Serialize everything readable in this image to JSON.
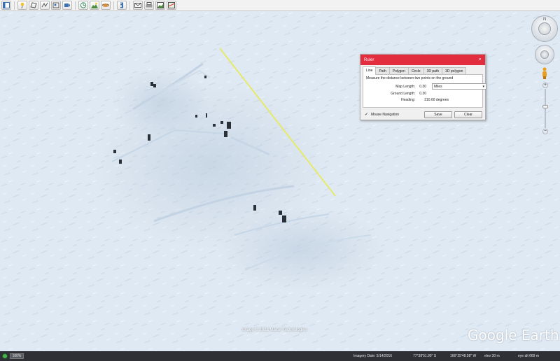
{
  "toolbar": {
    "buttons": [
      "sidebar",
      "placemark",
      "polygon",
      "path",
      "image-overlay",
      "record-tour",
      "historical-imagery",
      "sun",
      "planets",
      "ruler",
      "email",
      "print",
      "save-image",
      "view-in-maps"
    ]
  },
  "ruler": {
    "title": "Ruler",
    "close_glyph": "×",
    "tabs": [
      "Line",
      "Path",
      "Polygon",
      "Circle",
      "3D path",
      "3D polygon"
    ],
    "active_tab": "Line",
    "description": "Measure the distance between two points on the ground",
    "map_length_label": "Map Length:",
    "map_length_value": "0.30",
    "unit": "Miles",
    "ground_length_label": "Ground Length:",
    "ground_length_value": "0.30",
    "heading_label": "Heading:",
    "heading_value": "210.60 degrees",
    "mouse_nav_label": "Mouse Navigation",
    "mouse_nav_checked": true,
    "save_label": "Save",
    "clear_label": "Clear"
  },
  "map": {
    "copyright": "Image © 2021 Maxar Technologies",
    "logo": "Google Earth",
    "measure_line_color": "#e6ea6a",
    "snow_color": "#dfe9f3",
    "north_label": "N"
  },
  "status": {
    "streaming_pct": "100%",
    "imagery_date": "Imagery Date: 5/14/2016",
    "latitude": "77°38'51.90\" S",
    "longitude": "166°25'48.58\" W",
    "elevation": "elev   30 m",
    "eye_alt": "eye alt   669 m"
  },
  "colors": {
    "title_bar": "#e22d3e",
    "status_bg": "#2e3035"
  }
}
